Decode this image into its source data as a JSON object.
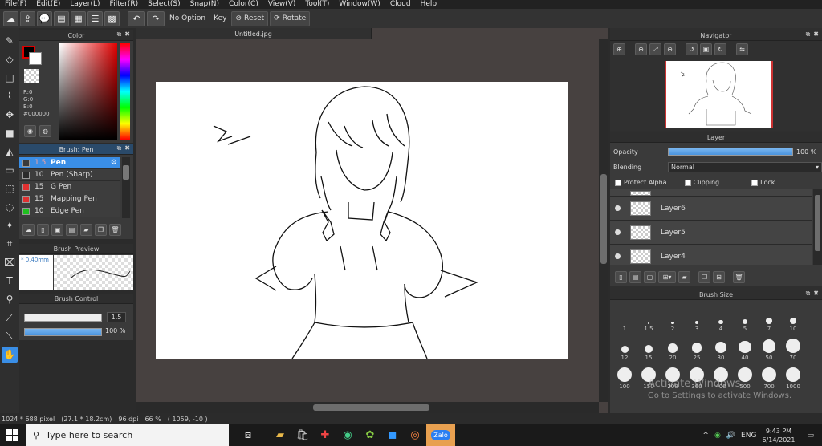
{
  "menu": [
    "File(F)",
    "Edit(E)",
    "Layer(L)",
    "Filter(R)",
    "Select(S)",
    "Snap(N)",
    "Color(C)",
    "View(V)",
    "Tool(T)",
    "Window(W)",
    "Cloud",
    "Help"
  ],
  "toolbar": {
    "no_option": "No Option",
    "key": "Key",
    "reset": "Reset",
    "rotate": "Rotate"
  },
  "color_panel": {
    "title": "Color",
    "r": "R:0",
    "g": "G:0",
    "b": "B:0",
    "hex": "#000000"
  },
  "brush_panel": {
    "title": "Brush: Pen",
    "items": [
      {
        "size": "1.5",
        "name": "Pen",
        "color": "#3a3a3a"
      },
      {
        "size": "10",
        "name": "Pen (Sharp)",
        "color": "#2b2b2b"
      },
      {
        "size": "15",
        "name": "G Pen",
        "color": "#e03030"
      },
      {
        "size": "15",
        "name": "Mapping Pen",
        "color": "#e03030"
      },
      {
        "size": "10",
        "name": "Edge Pen",
        "color": "#20c020"
      }
    ]
  },
  "brush_preview": {
    "title": "Brush Preview",
    "size": "* 0.40mm"
  },
  "brush_control": {
    "title": "Brush Control",
    "size": "1.5",
    "opacity": "100 %",
    "opacity_fraction": 1.0
  },
  "document": {
    "tab": "Untitled.jpg"
  },
  "status": {
    "size": "1024 * 688 pixel",
    "cm": "(27.1 * 18.2cm)",
    "dpi": "96 dpi",
    "zoom": "66 %",
    "coords": "( 1059, -10 )"
  },
  "navigator": {
    "title": "Navigator"
  },
  "layer_panel": {
    "title": "Layer",
    "opacity_label": "Opacity",
    "opacity_value": "100 %",
    "opacity_fraction": 1.0,
    "blending_label": "Blending",
    "blending_value": "Normal",
    "protect_alpha": "Protect Alpha",
    "clipping": "Clipping",
    "lock": "Lock",
    "layers": [
      "Layer6",
      "Layer5",
      "Layer4"
    ]
  },
  "brush_size": {
    "title": "Brush Size",
    "sizes": [
      "1",
      "1.5",
      "2",
      "3",
      "4",
      "5",
      "7",
      "10",
      "12",
      "15",
      "20",
      "25",
      "30",
      "40",
      "50",
      "70",
      "100",
      "150",
      "200",
      "300",
      "400",
      "500",
      "700",
      "1000"
    ]
  },
  "watermark": {
    "line1": "Activate Windows",
    "line2": "Go to Settings to activate Windows."
  },
  "taskbar": {
    "search_placeholder": "Type here to search",
    "lang": "ENG",
    "time": "9:43 PM",
    "date": "6/14/2021",
    "zalo": "Zalo"
  }
}
